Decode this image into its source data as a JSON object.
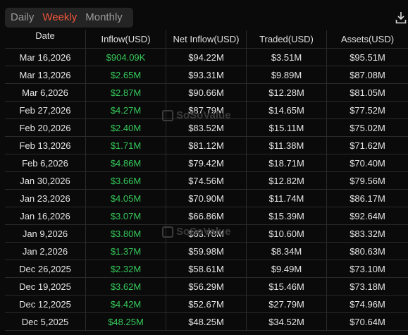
{
  "tabs": [
    {
      "label": "Daily",
      "active": false
    },
    {
      "label": "Weekly",
      "active": true
    },
    {
      "label": "Monthly",
      "active": false
    }
  ],
  "download_icon": "download-icon",
  "colors": {
    "accent": "#f0563a",
    "positive": "#35c95a"
  },
  "columns": [
    "Date",
    "Inflow(USD)",
    "Net Inflow(USD)",
    "Traded(USD)",
    "Assets(USD)"
  ],
  "watermark": {
    "text": "SoSoValue",
    "sub": "sosovalue.com"
  },
  "rows": [
    {
      "date": "Mar 16,2026",
      "inflow": "$904.09K",
      "net_inflow": "$94.22M",
      "traded": "$3.51M",
      "assets": "$95.51M"
    },
    {
      "date": "Mar 13,2026",
      "inflow": "$2.65M",
      "net_inflow": "$93.31M",
      "traded": "$9.89M",
      "assets": "$87.08M"
    },
    {
      "date": "Mar 6,2026",
      "inflow": "$2.87M",
      "net_inflow": "$90.66M",
      "traded": "$12.28M",
      "assets": "$81.05M"
    },
    {
      "date": "Feb 27,2026",
      "inflow": "$4.27M",
      "net_inflow": "$87.79M",
      "traded": "$14.65M",
      "assets": "$77.52M"
    },
    {
      "date": "Feb 20,2026",
      "inflow": "$2.40M",
      "net_inflow": "$83.52M",
      "traded": "$15.11M",
      "assets": "$75.02M"
    },
    {
      "date": "Feb 13,2026",
      "inflow": "$1.71M",
      "net_inflow": "$81.12M",
      "traded": "$11.38M",
      "assets": "$71.62M"
    },
    {
      "date": "Feb 6,2026",
      "inflow": "$4.86M",
      "net_inflow": "$79.42M",
      "traded": "$18.71M",
      "assets": "$70.40M"
    },
    {
      "date": "Jan 30,2026",
      "inflow": "$3.66M",
      "net_inflow": "$74.56M",
      "traded": "$12.82M",
      "assets": "$79.56M"
    },
    {
      "date": "Jan 23,2026",
      "inflow": "$4.05M",
      "net_inflow": "$70.90M",
      "traded": "$11.74M",
      "assets": "$86.17M"
    },
    {
      "date": "Jan 16,2026",
      "inflow": "$3.07M",
      "net_inflow": "$66.86M",
      "traded": "$15.39M",
      "assets": "$92.64M"
    },
    {
      "date": "Jan 9,2026",
      "inflow": "$3.80M",
      "net_inflow": "$63.78M",
      "traded": "$10.60M",
      "assets": "$83.32M"
    },
    {
      "date": "Jan 2,2026",
      "inflow": "$1.37M",
      "net_inflow": "$59.98M",
      "traded": "$8.34M",
      "assets": "$80.63M"
    },
    {
      "date": "Dec 26,2025",
      "inflow": "$2.32M",
      "net_inflow": "$58.61M",
      "traded": "$9.49M",
      "assets": "$73.10M"
    },
    {
      "date": "Dec 19,2025",
      "inflow": "$3.62M",
      "net_inflow": "$56.29M",
      "traded": "$15.46M",
      "assets": "$73.18M"
    },
    {
      "date": "Dec 12,2025",
      "inflow": "$4.42M",
      "net_inflow": "$52.67M",
      "traded": "$27.79M",
      "assets": "$74.96M"
    },
    {
      "date": "Dec 5,2025",
      "inflow": "$48.25M",
      "net_inflow": "$48.25M",
      "traded": "$34.52M",
      "assets": "$70.64M"
    }
  ]
}
